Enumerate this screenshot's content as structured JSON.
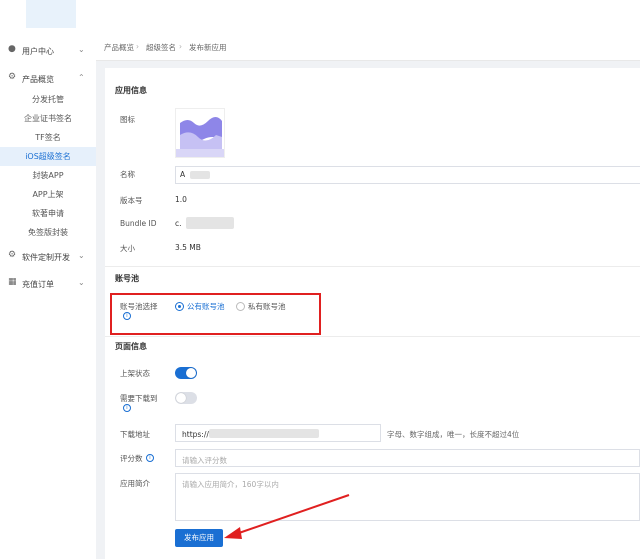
{
  "sidebar": {
    "groups": [
      {
        "label": "用户中心",
        "icon": "user-icon"
      },
      {
        "label": "产品概览",
        "icon": "gear-icon"
      },
      {
        "label": "软件定制开发",
        "icon": "gear-icon"
      },
      {
        "label": "充值订单",
        "icon": "calendar-icon"
      }
    ],
    "items": [
      {
        "label": "分发托管"
      },
      {
        "label": "企业证书签名"
      },
      {
        "label": "TF签名"
      },
      {
        "label": "iOS超级签名"
      },
      {
        "label": "封装APP"
      },
      {
        "label": "APP上架"
      },
      {
        "label": "软著申请"
      },
      {
        "label": "免签版封装"
      }
    ]
  },
  "breadcrumb": [
    "产品概览",
    "超级签名",
    "发布新应用"
  ],
  "app_info": {
    "section_title": "应用信息",
    "icon_label": "图标",
    "name_label": "名称",
    "name_value": "A",
    "version_label": "版本号",
    "version_value": "1.0",
    "bundle_label": "Bundle ID",
    "bundle_value": "c.",
    "size_label": "大小",
    "size_value": "3.5 MB"
  },
  "account_pool": {
    "section_title": "账号池",
    "select_label": "账号池选择",
    "option_public": "公有账号池",
    "option_private": "私有账号池"
  },
  "page_info": {
    "section_title": "页面信息",
    "listing_label": "上架状态",
    "require_download_label": "需要下载到",
    "download_url_label": "下载地址",
    "download_url_value": "https://",
    "download_url_hint": "字母、数字组成，唯一，长度不超过4位",
    "rating_label": "评分数",
    "rating_placeholder": "请输入评分数",
    "intro_label": "应用简介",
    "intro_placeholder": "请输入应用简介，160字以内"
  },
  "publish_button": "发布应用",
  "colors": {
    "primary": "#1a6fd3",
    "highlight": "#e02020"
  }
}
